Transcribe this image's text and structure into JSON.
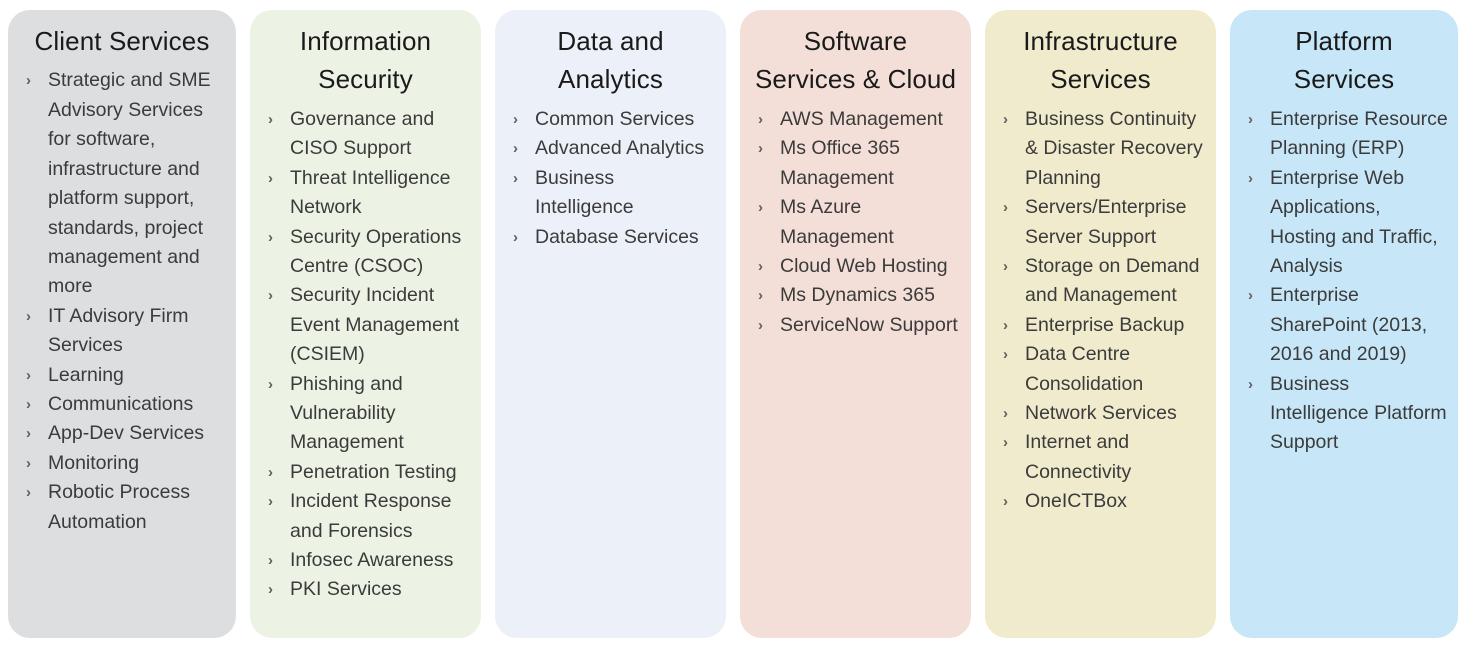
{
  "page": {
    "background": "#ffffff",
    "title_color": "#1a1a1a",
    "item_color": "#3b3b3b",
    "bullet_glyph": "›",
    "bullet_name": "chevron-right-icon"
  },
  "columns": [
    {
      "id": "client-services",
      "title": "Client Services",
      "color": "#dddee0",
      "items": [
        "Strategic and SME Advisory Services for software, infrastructure and platform support, standards, project management and more",
        "IT Advisory Firm Services",
        "Learning",
        "Communications",
        "App-Dev Services",
        "Monitoring",
        "Robotic Process Automation"
      ]
    },
    {
      "id": "information-security",
      "title": "Information Security",
      "color": "#ecf3e4",
      "items": [
        "Governance and CISO Support",
        "Threat Intelligence Network",
        "Security Operations Centre (CSOC)",
        "Security Incident Event Management (CSIEM)",
        "Phishing and Vulnerability Management",
        "Penetration Testing",
        "Incident Response and Forensics",
        "Infosec Awareness",
        "PKI Services"
      ]
    },
    {
      "id": "data-and-analytics",
      "title": "Data and Analytics",
      "color": "#ecf0f8",
      "items": [
        "Common Services",
        "Advanced Analytics",
        "Business Intelligence",
        "Database Services"
      ]
    },
    {
      "id": "software-services-and-cloud",
      "title": "Software Services & Cloud",
      "color": "#f4dfd8",
      "items": [
        "AWS Management",
        "Ms Office 365 Management",
        "Ms Azure Management",
        "Cloud Web Hosting",
        "Ms Dynamics 365",
        "ServiceNow Support"
      ]
    },
    {
      "id": "infrastructure-services",
      "title": "Infrastructure Services",
      "color": "#f0ebcd",
      "items": [
        "Business Continuity & Disaster Recovery Planning",
        "Servers/Enterprise Server Support",
        "Storage on Demand and Management",
        "Enterprise Backup",
        "Data Centre Consolidation",
        "Network Services",
        "Internet and Connectivity",
        "OneICTBox"
      ]
    },
    {
      "id": "platform-services",
      "title": "Platform Services",
      "color": "#c7e7f8",
      "items": [
        "Enterprise Resource Planning (ERP)",
        "Enterprise Web Applications, Hosting and Traffic, Analysis",
        "Enterprise SharePoint (2013, 2016 and 2019)",
        "Business Intelligence Platform Support"
      ]
    }
  ]
}
